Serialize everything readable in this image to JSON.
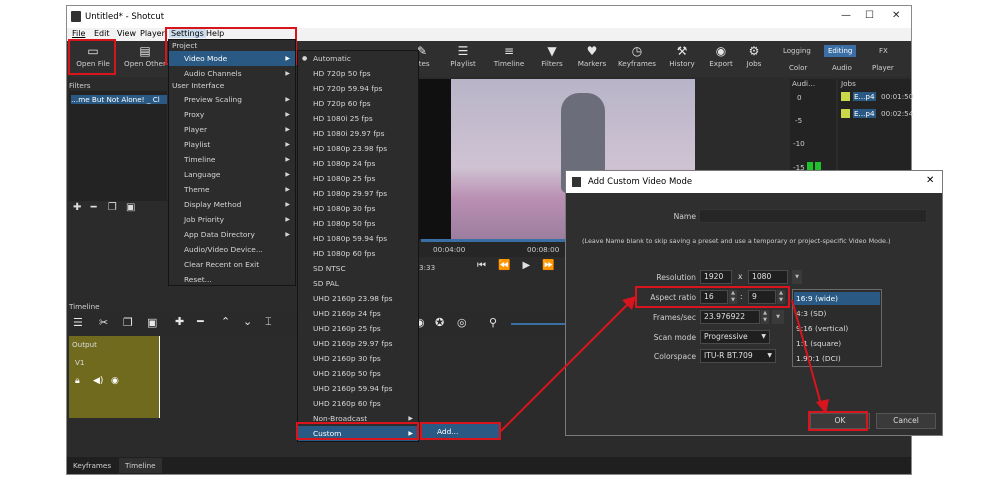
{
  "window": {
    "title": "Untitled* - Shotcut",
    "minimize": "—",
    "maximize": "☐",
    "close": "✕"
  },
  "menubar": [
    "File",
    "Edit",
    "View",
    "Player",
    "Settings",
    "Help"
  ],
  "toolbar": {
    "buttons": [
      {
        "label": "Open File",
        "icon": "folder-icon"
      },
      {
        "label": "Open Other",
        "icon": "open-other-icon"
      },
      {
        "label": "otes",
        "icon": "notes-icon"
      },
      {
        "label": "Playlist",
        "icon": "playlist-icon"
      },
      {
        "label": "Timeline",
        "icon": "timeline-icon"
      },
      {
        "label": "Filters",
        "icon": "filter-icon"
      },
      {
        "label": "Markers",
        "icon": "marker-icon"
      },
      {
        "label": "Keyframes",
        "icon": "keyframes-icon"
      },
      {
        "label": "History",
        "icon": "history-icon"
      },
      {
        "label": "Export",
        "icon": "export-icon"
      },
      {
        "label": "Jobs",
        "icon": "jobs-icon"
      }
    ],
    "layouts_top": [
      "Logging",
      "Editing",
      "FX"
    ],
    "layouts_bottom": [
      "Color",
      "Audio",
      "Player"
    ]
  },
  "left_panel": {
    "clip": "…me But Not Alone! _ Cl",
    "filters_label": "Filters"
  },
  "audio": {
    "title": "Audi…",
    "levels": [
      "0",
      "-5",
      "-10",
      "-15"
    ]
  },
  "jobs": {
    "title": "Jobs",
    "items": [
      {
        "name": "E...p4",
        "time": "00:01:50"
      },
      {
        "name": "E...p4",
        "time": "00:02:54"
      }
    ]
  },
  "player": {
    "time1": "00:04:00",
    "time2": "00:08:00",
    "tc": "3:33"
  },
  "timeline": {
    "label": "Timeline",
    "output": "Output",
    "track": "V1"
  },
  "bottom_tabs": [
    "Keyframes",
    "Timeline"
  ],
  "settings_menu": {
    "header_project": "Project",
    "video_mode": "Video Mode",
    "audio_channels": "Audio Channels",
    "header_ui": "User Interface",
    "items": [
      "Preview Scaling",
      "Proxy",
      "Player",
      "Playlist",
      "Timeline",
      "Language",
      "Theme",
      "Display Method",
      "Job Priority",
      "App Data Directory",
      "Audio/Video Device...",
      "Clear Recent on Exit",
      "Reset..."
    ]
  },
  "video_modes": [
    "Automatic",
    "HD 720p 50 fps",
    "HD 720p 59.94 fps",
    "HD 720p 60 fps",
    "HD 1080i 25 fps",
    "HD 1080i 29.97 fps",
    "HD 1080p 23.98 fps",
    "HD 1080p 24 fps",
    "HD 1080p 25 fps",
    "HD 1080p 29.97 fps",
    "HD 1080p 30 fps",
    "HD 1080p 50 fps",
    "HD 1080p 59.94 fps",
    "HD 1080p 60 fps",
    "SD NTSC",
    "SD PAL",
    "UHD 2160p 23.98 fps",
    "UHD 2160p 24 fps",
    "UHD 2160p 25 fps",
    "UHD 2160p 29.97 fps",
    "UHD 2160p 30 fps",
    "UHD 2160p 50 fps",
    "UHD 2160p 59.94 fps",
    "UHD 2160p 60 fps",
    "Non-Broadcast",
    "Custom"
  ],
  "custom_submenu": {
    "add": "Add..."
  },
  "dialog": {
    "title": "Add Custom Video Mode",
    "name_label": "Name",
    "name_value": "",
    "hint": "(Leave Name blank to skip saving a preset and use a temporary or project-specific Video Mode.)",
    "resolution_label": "Resolution",
    "res_w": "1920",
    "res_x": "x",
    "res_h": "1080",
    "aspect_label": "Aspect ratio",
    "aspect_w": "16",
    "aspect_sep": ":",
    "aspect_h": "9",
    "fps_label": "Frames/sec",
    "fps_value": "23.976922",
    "scan_label": "Scan mode",
    "scan_value": "Progressive",
    "colorspace_label": "Colorspace",
    "colorspace_value": "ITU-R BT.709",
    "aspect_options": [
      "16:9 (wide)",
      "4:3 (SD)",
      "9:16 (vertical)",
      "1:1 (square)",
      "1.90:1 (DCI)"
    ],
    "ok": "OK",
    "cancel": "Cancel"
  },
  "colors": {
    "highlight": "#d8141c",
    "menu_selection": "#2a5a83",
    "timeline_track": "#6f6a1e"
  }
}
